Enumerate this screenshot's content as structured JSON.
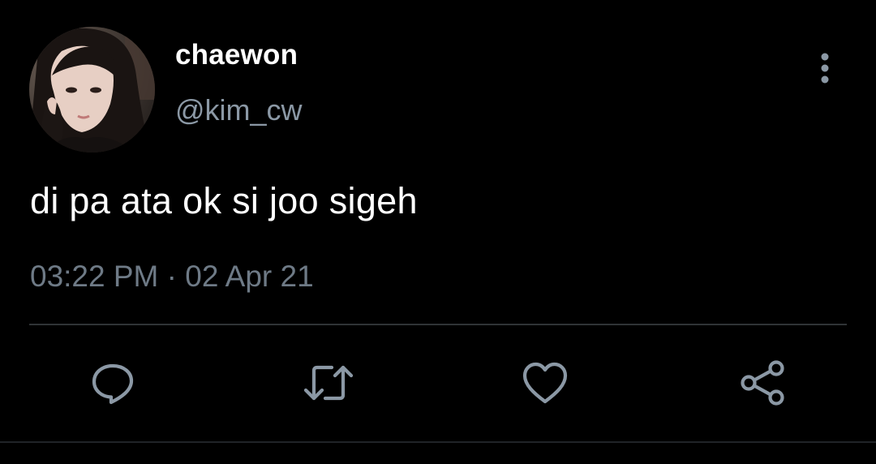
{
  "tweet": {
    "author": {
      "display_name": "chaewon",
      "handle": "@kim_cw"
    },
    "text": "di pa ata ok si joo sigeh",
    "time": "03:22 PM",
    "separator": "·",
    "date": "02 Apr 21"
  },
  "actions": [
    {
      "name": "reply",
      "icon": "speech-bubble-icon"
    },
    {
      "name": "retweet",
      "icon": "retweet-icon"
    },
    {
      "name": "like",
      "icon": "heart-icon"
    },
    {
      "name": "share",
      "icon": "share-icon"
    }
  ],
  "colors": {
    "background": "#000000",
    "primary_text": "#ffffff",
    "secondary_text": "#8b98a5",
    "timestamp_text": "#6e7a86",
    "icon": "#8b98a5",
    "divider": "#2f3336"
  }
}
